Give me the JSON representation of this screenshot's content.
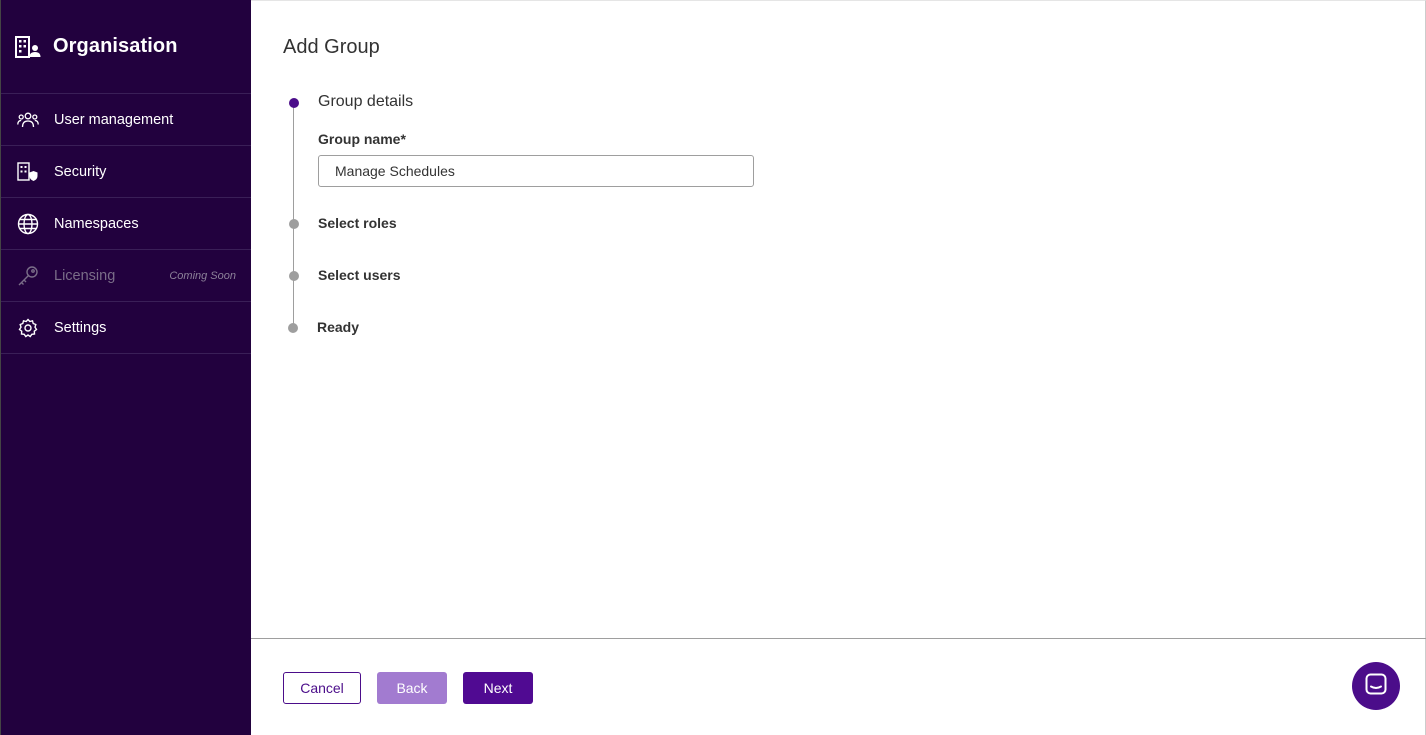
{
  "sidebar": {
    "title": "Organisation",
    "title_icon": "building-user-icon",
    "items": [
      {
        "label": "User management",
        "icon": "users-icon"
      },
      {
        "label": "Security",
        "icon": "building-shield-icon"
      },
      {
        "label": "Namespaces",
        "icon": "globe-icon"
      },
      {
        "label": "Licensing",
        "icon": "key-icon",
        "badge": "Coming Soon",
        "disabled": true
      },
      {
        "label": "Settings",
        "icon": "gear-icon"
      }
    ]
  },
  "main": {
    "title": "Add Group",
    "steps": [
      {
        "label": "Group details",
        "active": true
      },
      {
        "label": "Select roles",
        "active": false
      },
      {
        "label": "Select users",
        "active": false
      },
      {
        "label": "Ready",
        "active": false
      }
    ],
    "form": {
      "group_name_label": "Group name*",
      "group_name_value": "Manage Schedules"
    },
    "buttons": {
      "cancel": "Cancel",
      "back": "Back",
      "next": "Next"
    },
    "chat_icon": "chat-icon"
  },
  "colors": {
    "sidebar_bg": "#22013e",
    "accent": "#4b0d8a",
    "back_button": "#a27bd0"
  }
}
